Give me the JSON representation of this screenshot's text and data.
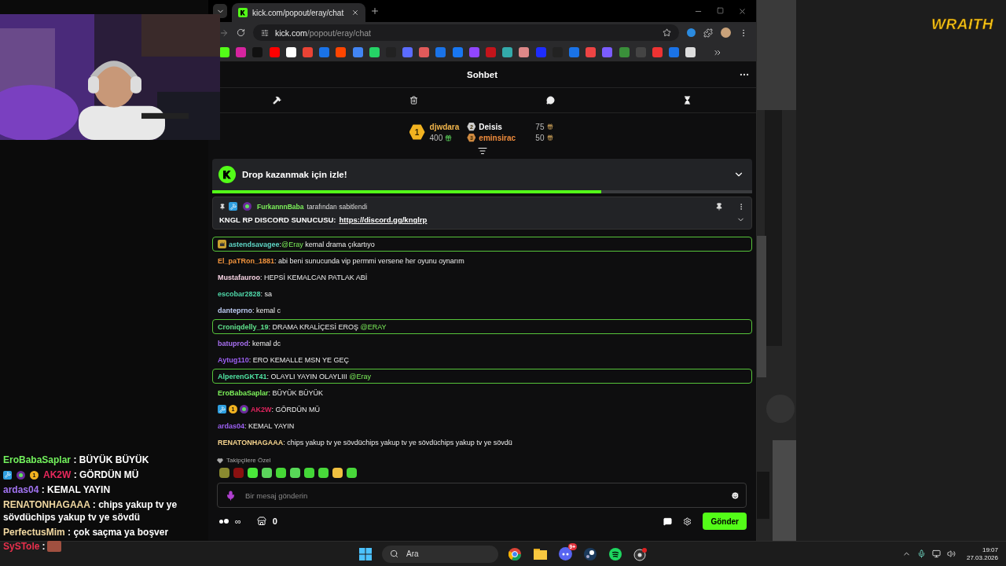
{
  "stream_overlay": {
    "logo": "WRAITH",
    "name_separator": ":"
  },
  "overlay_chat": [
    {
      "kind": "text",
      "user": "EroBabaSaplar",
      "color": "#72f05c",
      "text": "BÜYÜK BÜYÜK"
    },
    {
      "kind": "text",
      "user": "AK2W",
      "color": "#e8285c",
      "text": "GÖRDÜN MÜ",
      "badges": [
        {
          "kind": "moderator"
        },
        {
          "kind": "subscriber"
        },
        {
          "kind": "gifter",
          "label": "1"
        }
      ]
    },
    {
      "kind": "text",
      "user": "ardas04",
      "color": "#a274f2",
      "text": "KEMAL YAYIN"
    },
    {
      "kind": "text",
      "user": "RENATONHAGAAA",
      "color": "#f2d9a2",
      "text": "chips yakup tv ye sövdüchips yakup tv ye sövdü"
    },
    {
      "kind": "text",
      "user": "PerfectusMim",
      "color": "#f2d9a2",
      "text": "çok saçma ya boşver"
    },
    {
      "kind": "emote",
      "user": "SySTole",
      "color": "#e8304c"
    }
  ],
  "browser": {
    "tab_title": "kick.com/popout/eray/chat",
    "url_host": "kick.com",
    "url_path": "/popout/eray/chat"
  },
  "chat": {
    "title": "Sohbet",
    "name_separator": ":",
    "leaderboard": [
      {
        "kind": "top",
        "rank": "1",
        "user": "djwdara",
        "amount": "400",
        "color": "#f2b64c"
      },
      {
        "kind": "runner",
        "rank": "2",
        "user": "Deisis",
        "amount": "75",
        "color": "#ffffff"
      },
      {
        "kind": "runner",
        "rank": "3",
        "user": "eminsirac",
        "amount": "50",
        "color": "#f08c3c"
      }
    ],
    "drop": {
      "title": "Drop kazanmak için izle!",
      "level": 0.72
    },
    "pinned": {
      "by": "FurkannnBaba",
      "by_suffix": "tarafından sabitlendi",
      "label": "KNGL RP DISCORD SUNUCUSU:",
      "link": "https://discord.gg/knglrp"
    },
    "messages": [
      {
        "user": "astendsavagee",
        "color": "#5fd6c6",
        "highlighted": true,
        "badges": [
          {
            "kind": "crown"
          }
        ],
        "parts": [
          {
            "kind": "mention",
            "text": "@Eray"
          },
          {
            "kind": "plain",
            "text": " kemal drama çıkartıyo"
          }
        ]
      },
      {
        "user": "El_paTRon_1881",
        "color": "#f0923c",
        "highlighted": false,
        "parts": [
          {
            "kind": "plain",
            "text": " abi beni sunucunda vip permmi versene her oyunu oynarım"
          }
        ]
      },
      {
        "user": "Mustafauroo",
        "color": "#f6d2e2",
        "highlighted": false,
        "parts": [
          {
            "kind": "plain",
            "text": " HEPSİ KEMALCAN PATLAK ABİ"
          }
        ]
      },
      {
        "user": "escobar2828",
        "color": "#4fd6a8",
        "highlighted": false,
        "parts": [
          {
            "kind": "plain",
            "text": " sa"
          }
        ]
      },
      {
        "user": "danteprno",
        "color": "#bccaf2",
        "highlighted": false,
        "parts": [
          {
            "kind": "plain",
            "text": " kemal c"
          }
        ]
      },
      {
        "user": "Croniqdelly_19",
        "color": "#5fe28c",
        "highlighted": true,
        "parts": [
          {
            "kind": "plain",
            "text": " DRAMA KRALİÇESİ EROŞ "
          },
          {
            "kind": "mention",
            "text": "@ERAY"
          }
        ]
      },
      {
        "user": "batuprod",
        "color": "#a870f2",
        "highlighted": false,
        "parts": [
          {
            "kind": "plain",
            "text": " kemal dc"
          }
        ]
      },
      {
        "user": "Aytug110",
        "color": "#9c60f2",
        "highlighted": false,
        "parts": [
          {
            "kind": "plain",
            "text": " ERO KEMALLE MSN YE GEÇ"
          }
        ]
      },
      {
        "user": "AlperenGKT41",
        "color": "#4fe2a2",
        "highlighted": true,
        "parts": [
          {
            "kind": "plain",
            "text": " OLAYLI YAYIN OLAYLIII "
          },
          {
            "kind": "mention",
            "text": "@Eray"
          }
        ]
      },
      {
        "user": "EroBabaSaplar",
        "color": "#7cf05a",
        "highlighted": false,
        "parts": [
          {
            "kind": "plain",
            "text": " BÜYÜK BÜYÜK"
          }
        ]
      },
      {
        "user": "AK2W",
        "color": "#e0245e",
        "highlighted": false,
        "badges": [
          {
            "kind": "moderator"
          },
          {
            "kind": "gifter",
            "label": "1"
          },
          {
            "kind": "subscriber"
          }
        ],
        "parts": [
          {
            "kind": "plain",
            "text": " GÖRDÜN MÜ"
          }
        ]
      },
      {
        "user": "ardas04",
        "color": "#9c60f2",
        "highlighted": false,
        "parts": [
          {
            "kind": "plain",
            "text": " KEMAL YAYIN"
          }
        ]
      },
      {
        "user": "RENATONHAGAAA",
        "color": "#f6d48e",
        "highlighted": false,
        "parts": [
          {
            "kind": "plain",
            "text": " chips yakup tv ye sövdüchips yakup tv ye sövdüchips yakup tv ye sövdü"
          }
        ]
      }
    ],
    "emote_label": "Takipçilere Özel",
    "input": {
      "placeholder": "Bir mesaj gönderin"
    },
    "footer": {
      "infinity": "∞",
      "count": "0",
      "send": "Gönder"
    }
  },
  "taskbar": {
    "search_placeholder": "Ara",
    "discord_badge": "9+",
    "time": "19:07",
    "date": "27.03.2026"
  }
}
